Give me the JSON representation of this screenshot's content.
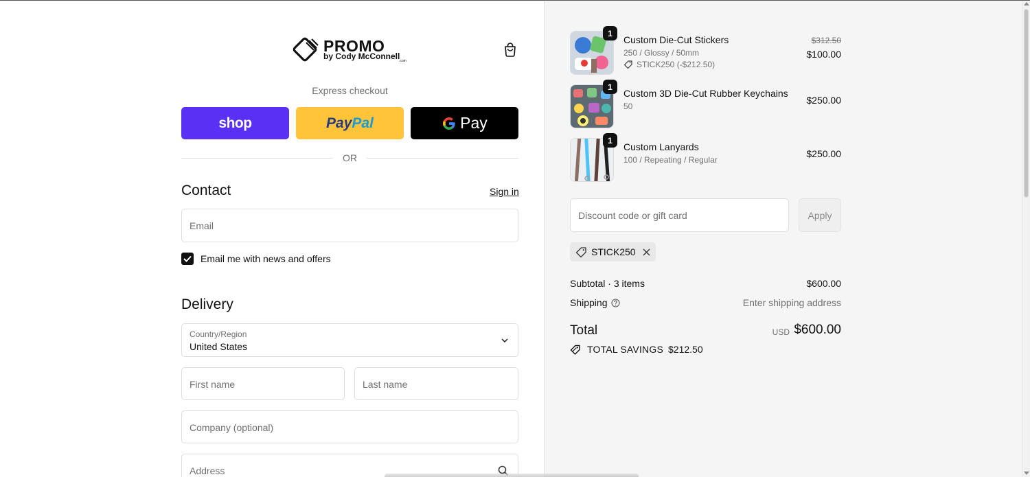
{
  "header": {
    "brand": "PROMO",
    "brand_sub": "by Cody McConnell",
    "brand_com": ".com",
    "cart_icon": "shopping-bag-icon"
  },
  "express": {
    "title": "Express checkout",
    "shop_label": "shop",
    "paypal_label_1": "Pay",
    "paypal_label_2": "Pal",
    "gpay_g": "G",
    "gpay_label": "Pay",
    "or_label": "OR"
  },
  "contact": {
    "heading": "Contact",
    "sign_in": "Sign in",
    "email_placeholder": "Email",
    "news_label": "Email me with news and offers",
    "news_checked": true
  },
  "delivery": {
    "heading": "Delivery",
    "country_label": "Country/Region",
    "country_value": "United States",
    "first_name_placeholder": "First name",
    "last_name_placeholder": "Last name",
    "company_placeholder": "Company (optional)",
    "address_placeholder": "Address"
  },
  "cart": {
    "items": [
      {
        "name": "Custom Die-Cut Stickers",
        "variant": "250 / Glossy / 50mm",
        "discount": "STICK250 (-$212.50)",
        "original_price": "$312.50",
        "price": "$100.00",
        "quantity": "1"
      },
      {
        "name": "Custom 3D Die-Cut Rubber Keychains",
        "variant": "50",
        "price": "$250.00",
        "quantity": "1"
      },
      {
        "name": "Custom Lanyards",
        "variant": "100 / Repeating / Regular",
        "price": "$250.00",
        "quantity": "1"
      }
    ],
    "discount_placeholder": "Discount code or gift card",
    "apply_label": "Apply",
    "applied_code": "STICK250",
    "subtotal_label": "Subtotal · 3 items",
    "subtotal_value": "$600.00",
    "shipping_label": "Shipping",
    "shipping_value": "Enter shipping address",
    "total_label": "Total",
    "total_currency": "USD",
    "total_value": "$600.00",
    "savings_label": "TOTAL SAVINGS",
    "savings_value": "$212.50"
  },
  "colors": {
    "shop_pay": "#5a31f4",
    "paypal": "#ffc439",
    "gpay": "#000000"
  }
}
